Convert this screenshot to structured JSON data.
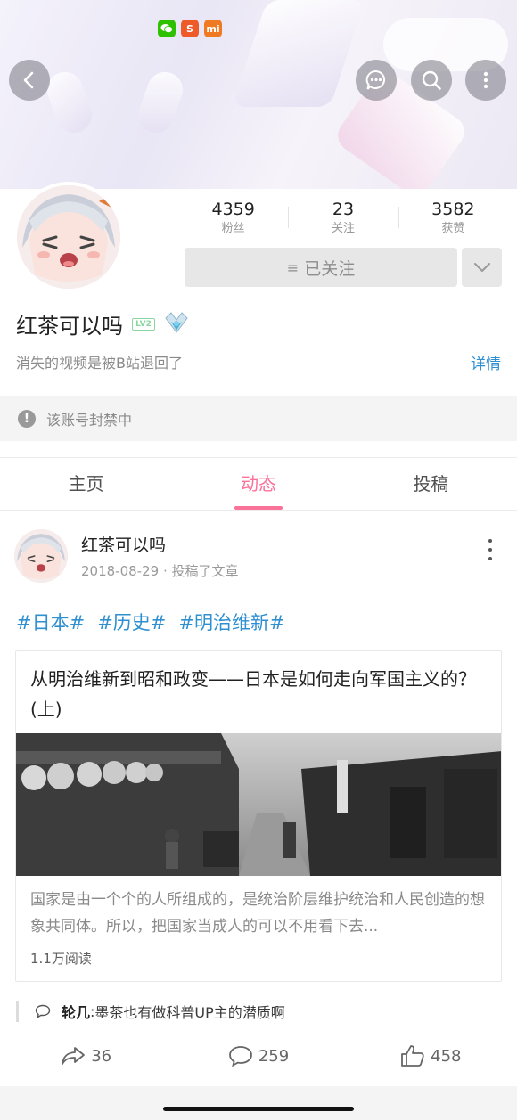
{
  "header": {
    "status_icons": [
      "wechat-icon",
      "sogou-s-icon",
      "mi-icon"
    ],
    "status_icon_labels": {
      "s": "S",
      "mi": "mi"
    }
  },
  "profile": {
    "stats": [
      {
        "value": "4359",
        "label": "粉丝"
      },
      {
        "value": "23",
        "label": "关注"
      },
      {
        "value": "3582",
        "label": "获赞"
      }
    ],
    "follow_label": "已关注",
    "name": "红茶可以吗",
    "level": "LV2",
    "signature": "消失的视频是被B站退回了",
    "detail_link": "详情"
  },
  "notice": {
    "text": "该账号封禁中"
  },
  "tabs": [
    {
      "label": "主页",
      "active": false
    },
    {
      "label": "动态",
      "active": true
    },
    {
      "label": "投稿",
      "active": false
    }
  ],
  "post": {
    "author": "红茶可以吗",
    "date": "2018-08-29",
    "action": "投稿了文章",
    "tags": [
      "#日本#",
      "#历史#",
      "#明治维新#"
    ],
    "article": {
      "title": "从明治维新到昭和政变——日本是如何走向军国主义的？(上)",
      "description": "国家是由一个个的人所组成的，是统治阶层维护统治和人民创造的想象共同体。所以，把国家当成人的可以不用看下去...",
      "reads": "1.1万阅读"
    },
    "hot_comment": {
      "user": "轮几",
      "text": "墨茶也有做科普UP主的潜质啊"
    },
    "actions": {
      "share": "36",
      "comment": "259",
      "like": "458"
    }
  },
  "colors": {
    "accent_pink": "#fb7299",
    "link_blue": "#2e8fd1"
  }
}
